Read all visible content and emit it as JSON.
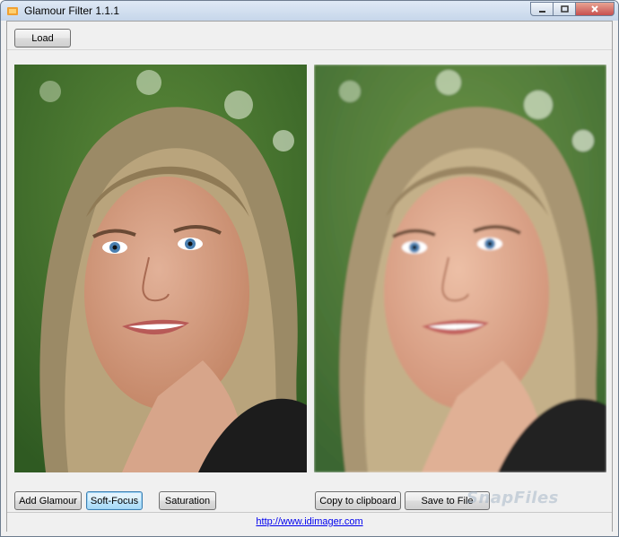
{
  "window": {
    "title": "Glamour Filter 1.1.1"
  },
  "toolbar": {
    "load_label": "Load"
  },
  "images": {
    "original": {
      "label": "original-photo"
    },
    "filtered": {
      "label": "filtered-photo"
    }
  },
  "buttons": {
    "add_glamour": "Add Glamour",
    "soft_focus": "Soft-Focus",
    "saturation": "Saturation",
    "copy_clipboard": "Copy to clipboard",
    "save_file": "Save to File"
  },
  "status": {
    "link": "http://www.idimager.com"
  },
  "watermark": "SnapFiles",
  "colors": {
    "link": "#0000ee",
    "close_button": "#c75050",
    "focus_border": "#3c7fb1"
  }
}
